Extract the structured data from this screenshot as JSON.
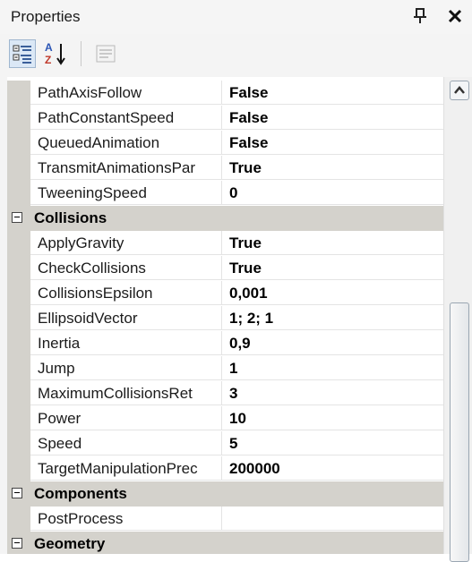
{
  "window": {
    "title": "Properties"
  },
  "toolbar": {
    "categorized_tooltip": "Categorized",
    "alphabetical_tooltip": "Alphabetical",
    "pages_tooltip": "Property Pages"
  },
  "grid": {
    "rows": [
      {
        "kind": "prop",
        "name": "PathAxisFollow",
        "value": "False"
      },
      {
        "kind": "prop",
        "name": "PathConstantSpeed",
        "value": "False"
      },
      {
        "kind": "prop",
        "name": "QueuedAnimation",
        "value": "False"
      },
      {
        "kind": "prop",
        "name": "TransmitAnimationsPar",
        "value": "True"
      },
      {
        "kind": "prop",
        "name": "TweeningSpeed",
        "value": "0"
      },
      {
        "kind": "category",
        "name": "Collisions"
      },
      {
        "kind": "prop",
        "name": "ApplyGravity",
        "value": "True"
      },
      {
        "kind": "prop",
        "name": "CheckCollisions",
        "value": "True"
      },
      {
        "kind": "prop",
        "name": "CollisionsEpsilon",
        "value": "0,001"
      },
      {
        "kind": "prop",
        "name": "EllipsoidVector",
        "value": "1; 2; 1"
      },
      {
        "kind": "prop",
        "name": "Inertia",
        "value": "0,9"
      },
      {
        "kind": "prop",
        "name": "Jump",
        "value": "1"
      },
      {
        "kind": "prop",
        "name": "MaximumCollisionsRet",
        "value": "3"
      },
      {
        "kind": "prop",
        "name": "Power",
        "value": "10"
      },
      {
        "kind": "prop",
        "name": "Speed",
        "value": "5"
      },
      {
        "kind": "prop",
        "name": "TargetManipulationPrec",
        "value": "200000"
      },
      {
        "kind": "category",
        "name": "Components"
      },
      {
        "kind": "prop",
        "name": "PostProcess",
        "value": ""
      },
      {
        "kind": "category",
        "name": "Geometry"
      }
    ]
  },
  "colors": {
    "category_band": "#d4d2cc",
    "grid_line": "#e4e4e4"
  }
}
